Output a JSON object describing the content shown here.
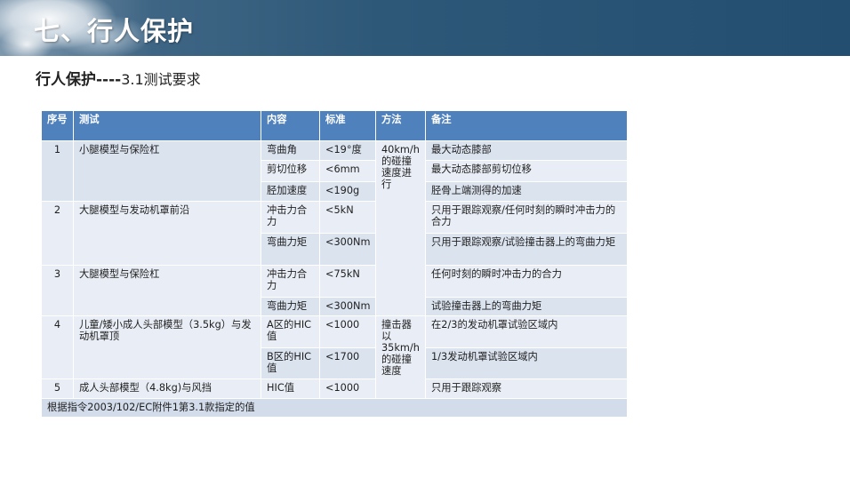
{
  "banner": {
    "title": "七、行人保护"
  },
  "subtitle": {
    "bold": "行人保护----",
    "normal": "3.1测试要求"
  },
  "table": {
    "headers": [
      "序号",
      "测试",
      "内容",
      "标准",
      "方法",
      "备注"
    ],
    "rows": [
      {
        "seq": "1",
        "test": "小腿模型与保险杠"
      },
      {
        "seq": "2",
        "test": "大腿模型与发动机罩前沿"
      },
      {
        "seq": "3",
        "test": "大腿模型与保险杠"
      },
      {
        "seq": "4",
        "test": "儿童/矮小成人头部模型（3.5kg）与发动机罩顶"
      },
      {
        "seq": "5",
        "test": "成人头部模型（4.8kg)与风挡"
      }
    ],
    "items": [
      {
        "content": "弯曲角",
        "standard": "<19°度",
        "note": "最大动态膝部"
      },
      {
        "content": "剪切位移",
        "standard": "<6mm",
        "note": "最大动态膝部剪切位移"
      },
      {
        "content": "胫加速度",
        "standard": "<190g",
        "note": "胫骨上端测得的加速"
      },
      {
        "content": "冲击力合力",
        "standard": "<5kN",
        "note": "只用于跟踪观察/任何时刻的瞬时冲击力的合力"
      },
      {
        "content": "弯曲力矩",
        "standard": "<300Nm",
        "note": "只用于跟踪观察/试验撞击器上的弯曲力矩"
      },
      {
        "content": "冲击力合力",
        "standard": "<75kN",
        "note": "任何时刻的瞬时冲击力的合力"
      },
      {
        "content": "弯曲力矩",
        "standard": "<300Nm",
        "note": "试验撞击器上的弯曲力矩"
      },
      {
        "content": "A区的HIC值",
        "standard": "<1000",
        "note": "在2/3的发动机罩试验区域内"
      },
      {
        "content": "B区的HIC值",
        "standard": "<1700",
        "note": "1/3发动机罩试验区域内"
      },
      {
        "content": "HIC值",
        "standard": "<1000",
        "note": "只用于跟踪观察"
      }
    ],
    "methods": [
      "40km/h的碰撞速度进行",
      "撞击器以35km/h的碰撞速度"
    ],
    "footer": "根据指令2003/102/EC附件1第3.1款指定的值"
  }
}
